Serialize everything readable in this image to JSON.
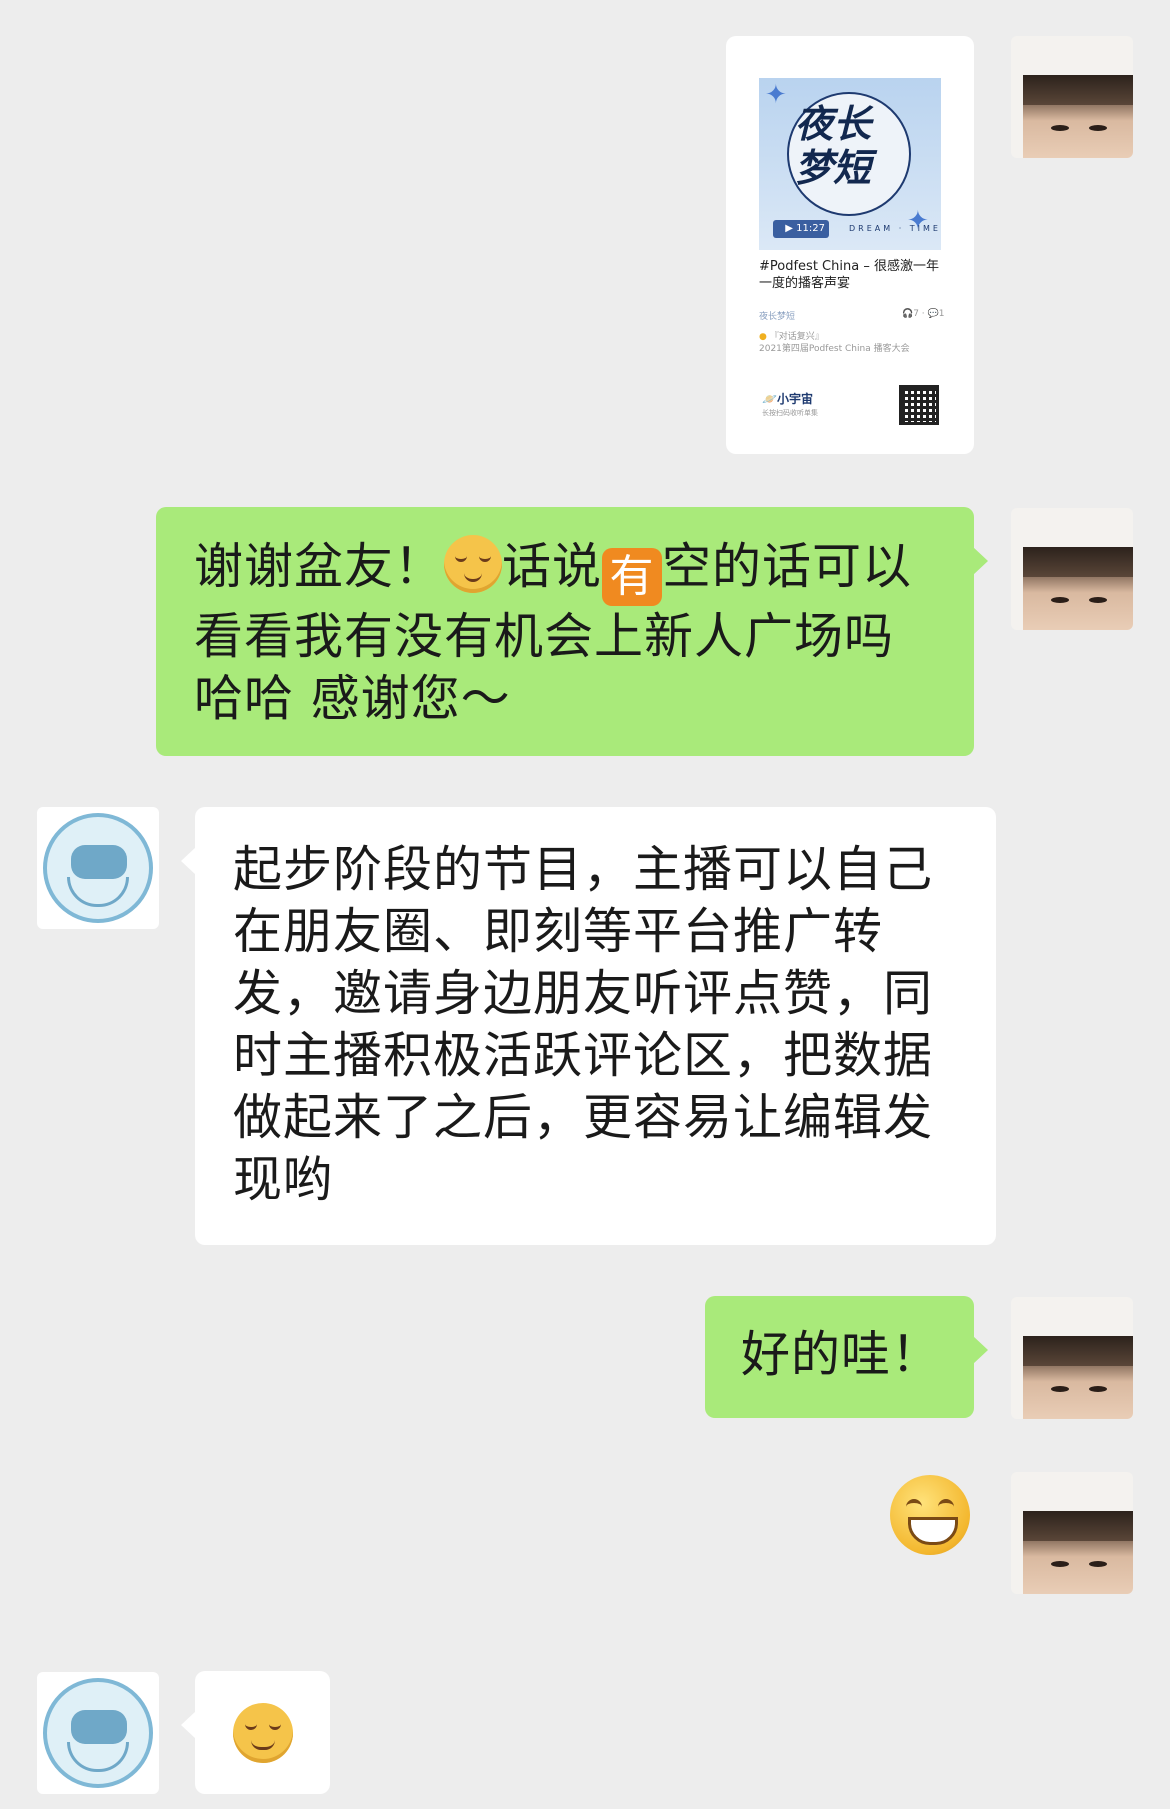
{
  "messages": {
    "card": {
      "cover_title": "夜长梦短",
      "cover_duration": "11:27",
      "cover_tagline": "DREAM · TIME",
      "desc": "#Podfest China – 很感激一年一度的播客声宴",
      "show_name": "夜长梦短",
      "stats": "🎧7 · 💬1",
      "event_tag": "『对话复兴』",
      "event_name": "2021第四届Podfest China 播客大会",
      "brand": "小宇宙",
      "brand_sub": "长按扫码收听单集"
    },
    "msg1": {
      "part1": "谢谢盆友！",
      "part2": "话说",
      "badge": "有",
      "part3": "空的话可以看看我有没有机会上新人广场吗哈哈 感谢您～"
    },
    "msg2": "起步阶段的节目，主播可以自己在朋友圈、即刻等平台推广转发，邀请身边朋友听评点赞，同时主播积极活跃评论区，把数据做起来了之后，更容易让编辑发现哟",
    "msg3": "好的哇！"
  },
  "icons": {
    "user_avatar": "user-avatar-photo",
    "bot_avatar": "astronaut-avatar",
    "sticker_grin": "grinning-squint-sticker",
    "sticker_smile": "smiling-blush-emoji",
    "inline_emoji": "relieved-face-emoji"
  },
  "colors": {
    "background": "#ededed",
    "self_bubble": "#a9ea7a",
    "other_bubble": "#ffffff"
  }
}
